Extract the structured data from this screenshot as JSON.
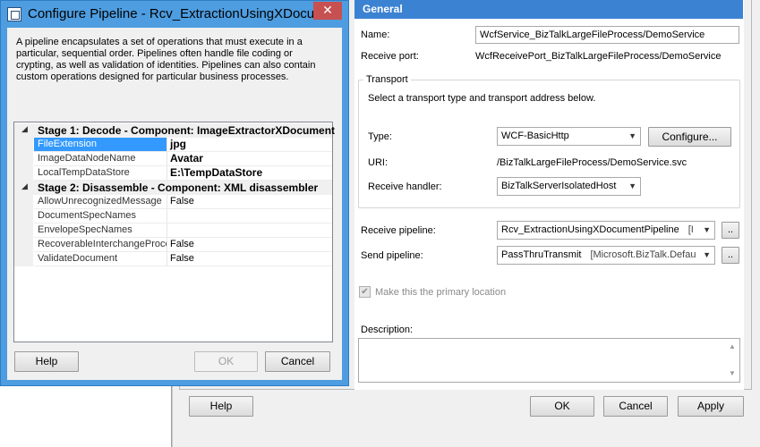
{
  "dialog": {
    "title": "Configure Pipeline - Rcv_ExtractionUsingXDocumentPipeline",
    "description": "A pipeline encapsulates a set of operations that must execute in a particular, sequential order. Pipelines often handle file coding or crypting, as well as validation of identities. Pipelines can also contain custom operations designed for particular business processes.",
    "close_glyph": "✕",
    "stages": [
      {
        "header": "Stage 1: Decode - Component: ImageExtractorXDocument",
        "properties": [
          {
            "name": "FileExtension",
            "value": "jpg",
            "selected": true
          },
          {
            "name": "ImageDataNodeName",
            "value": "Avatar"
          },
          {
            "name": "LocalTempDataStore",
            "value": "E:\\TempDataStore"
          }
        ]
      },
      {
        "header": "Stage 2: Disassemble - Component: XML disassembler",
        "properties": [
          {
            "name": "AllowUnrecognizedMessage",
            "value": "False"
          },
          {
            "name": "DocumentSpecNames",
            "value": ""
          },
          {
            "name": "EnvelopeSpecNames",
            "value": ""
          },
          {
            "name": "RecoverableInterchangeProcessing",
            "value": "False"
          },
          {
            "name": "ValidateDocument",
            "value": "False"
          }
        ]
      }
    ],
    "help_label": "Help",
    "ok_label": "OK",
    "cancel_label": "Cancel"
  },
  "receive_location": {
    "section_title": "General",
    "name_label": "Name:",
    "name_value": "WcfService_BizTalkLargeFileProcess/DemoService",
    "receive_port_label": "Receive port:",
    "receive_port_value": "WcfReceivePort_BizTalkLargeFileProcess/DemoService",
    "transport": {
      "group_title": "Transport",
      "instruction": "Select a transport type and transport address below.",
      "type_label": "Type:",
      "type_value": "WCF-BasicHttp",
      "configure_label": "Configure...",
      "uri_label": "URI:",
      "uri_value": "/BizTalkLargeFileProcess/DemoService.svc",
      "handler_label": "Receive handler:",
      "handler_value": "BizTalkServerIsolatedHost"
    },
    "receive_pipeline_label": "Receive pipeline:",
    "receive_pipeline_value": "Rcv_ExtractionUsingXDocumentPipeline",
    "receive_pipeline_extra": "[I",
    "send_pipeline_label": "Send pipeline:",
    "send_pipeline_value": "PassThruTransmit",
    "send_pipeline_extra": "[Microsoft.BizTalk.Defau",
    "ellipsis_label": "..",
    "primary_location_label": "Make this the primary location",
    "primary_location_checked": "✔",
    "description_label": "Description:",
    "help_label": "Help",
    "ok_label": "OK",
    "cancel_label": "Cancel",
    "apply_label": "Apply"
  }
}
